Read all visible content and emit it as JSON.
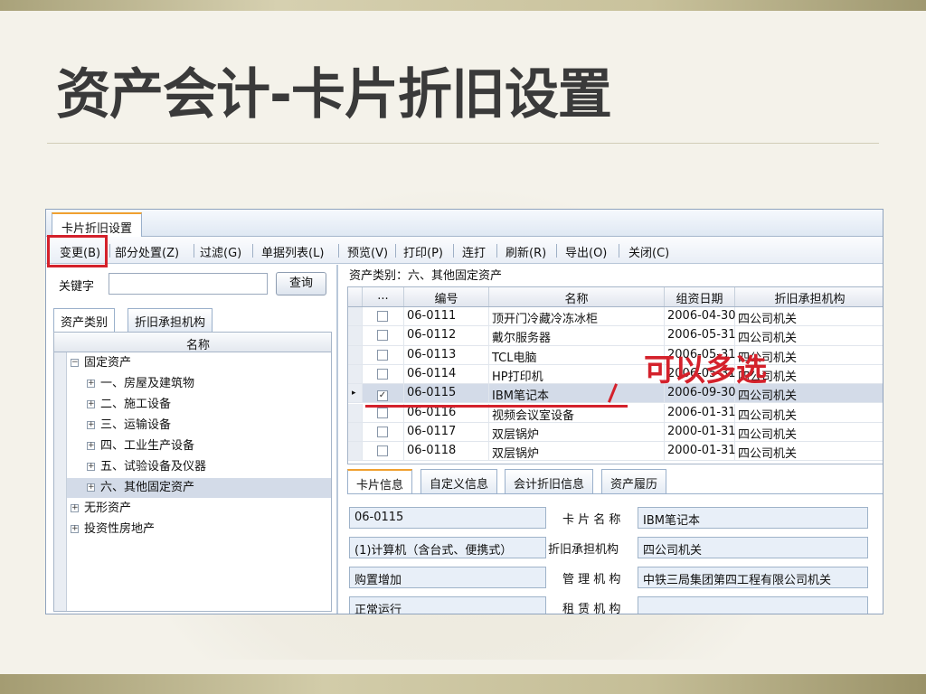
{
  "slide": {
    "title": "资产会计-卡片折旧设置"
  },
  "window": {
    "tab_title": "卡片折旧设置"
  },
  "menu": [
    {
      "label": "变更(B)"
    },
    {
      "label": "部分处置(Z)"
    },
    {
      "label": "过滤(G)"
    },
    {
      "label": "单据列表(L)"
    },
    {
      "label": "预览(V)"
    },
    {
      "label": "打印(P)"
    },
    {
      "label": "连打"
    },
    {
      "label": "刷新(R)"
    },
    {
      "label": "导出(O)"
    },
    {
      "label": "关闭(C)"
    }
  ],
  "search": {
    "label": "关键字",
    "value": "",
    "button": "查询"
  },
  "left_tabs": [
    "资产类别",
    "折旧承担机构"
  ],
  "tree": {
    "header": "名称",
    "nodes": [
      {
        "label": "固定资产",
        "expander": "minus"
      },
      {
        "label": "一、房屋及建筑物",
        "expander": "plus"
      },
      {
        "label": "二、施工设备",
        "expander": "plus"
      },
      {
        "label": "三、运输设备",
        "expander": "plus"
      },
      {
        "label": "四、工业生产设备",
        "expander": "plus"
      },
      {
        "label": "五、试验设备及仪器",
        "expander": "plus"
      },
      {
        "label": "六、其他固定资产",
        "expander": "plus",
        "selected": true
      },
      {
        "label": "无形资产",
        "expander": "plus"
      },
      {
        "label": "投资性房地产",
        "expander": "plus"
      }
    ]
  },
  "breadcrumb": "资产类别：六、其他固定资产",
  "grid": {
    "columns": [
      "...",
      "编号",
      "名称",
      "组资日期",
      "折旧承担机构"
    ],
    "rows": [
      {
        "checked": false,
        "code": "06-0111",
        "name": "顶开门冷藏冷冻冰柜",
        "date": "2006-04-30",
        "org": "四公司机关"
      },
      {
        "checked": false,
        "code": "06-0112",
        "name": "戴尔服务器",
        "date": "2006-05-31",
        "org": "四公司机关"
      },
      {
        "checked": false,
        "code": "06-0113",
        "name": "TCL电脑",
        "date": "2006-05-31",
        "org": "四公司机关"
      },
      {
        "checked": false,
        "code": "06-0114",
        "name": "HP打印机",
        "date": "2006-05-31",
        "org": "四公司机关"
      },
      {
        "checked": true,
        "code": "06-0115",
        "name": "IBM笔记本",
        "date": "2006-09-30",
        "org": "四公司机关",
        "selected": true
      },
      {
        "checked": false,
        "code": "06-0116",
        "name": "视频会议室设备",
        "date": "2006-01-31",
        "org": "四公司机关"
      },
      {
        "checked": false,
        "code": "06-0117",
        "name": "双层锅炉",
        "date": "2000-01-31",
        "org": "四公司机关"
      },
      {
        "checked": false,
        "code": "06-0118",
        "name": "双层锅炉",
        "date": "2000-01-31",
        "org": "四公司机关"
      }
    ]
  },
  "annotation": "可以多选",
  "detail_tabs": [
    "卡片信息",
    "自定义信息",
    "会计折旧信息",
    "资产履历"
  ],
  "detail": {
    "code": "06-0115",
    "category": "(1)计算机（含台式、便携式）",
    "add_method": "购置增加",
    "status": "正常运行",
    "card_name_label": "卡 片 名 称",
    "card_name": "IBM笔记本",
    "org_label": "折旧承担机构",
    "org": "四公司机关",
    "manage_label": "管 理 机 构",
    "manage": "中铁三局集团第四工程有限公司机关",
    "lease_label": "租 赁 机 构",
    "lease": ""
  },
  "colors": {
    "accent_red": "#d4212b",
    "selection": "#d3dbe8",
    "tab_orange": "#f0a030"
  }
}
